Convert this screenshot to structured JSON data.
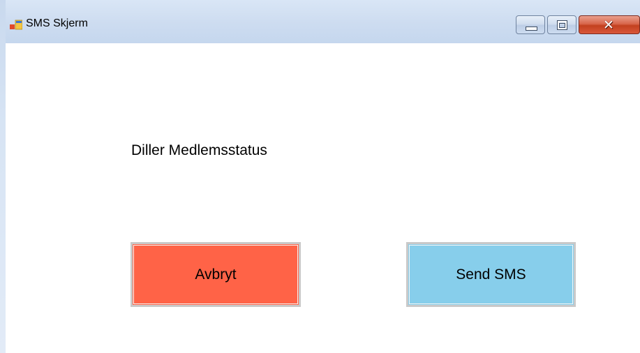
{
  "window": {
    "title": "SMS Skjerm",
    "icon": "windows-form-icon",
    "controls": {
      "minimize_icon": "minimize-icon",
      "maximize_icon": "maximize-icon",
      "close_icon": "close-icon",
      "close_glyph": "✕"
    }
  },
  "form": {
    "status_label": "Diller Medlemsstatus",
    "buttons": {
      "cancel_label": "Avbryt",
      "cancel_color": "#ff6347",
      "send_label": "Send SMS",
      "send_color": "#87ceeb"
    }
  }
}
